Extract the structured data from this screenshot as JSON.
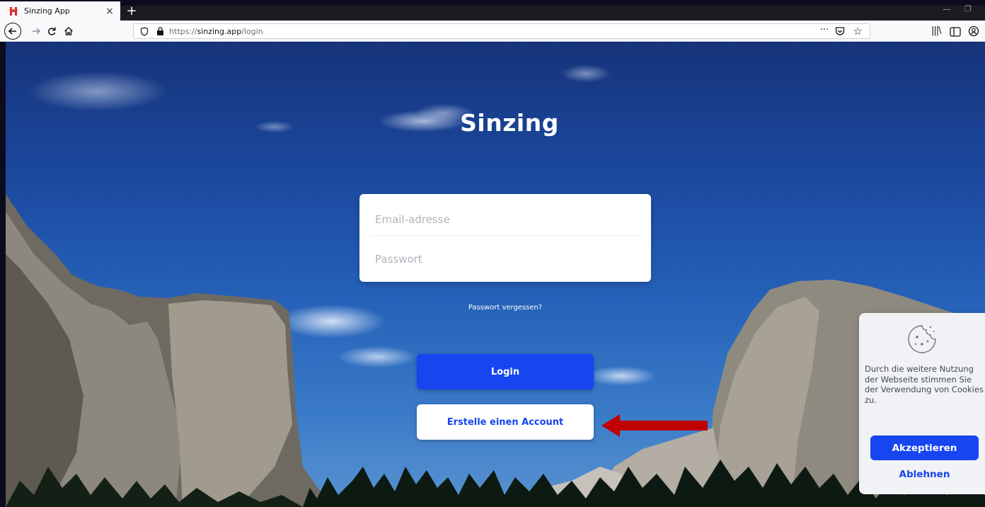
{
  "browser": {
    "tab_title": "Sinzing App",
    "tab_close": "×",
    "new_tab": "+",
    "url_scheme": "https://",
    "url_host": "sinzing.app",
    "url_path": "/login",
    "page_actions": "···",
    "bookmark_star": "☆",
    "library": "|||\\"
  },
  "page": {
    "brand_title": "Sinzing",
    "email_placeholder": "Email-adresse",
    "password_placeholder": "Passwort",
    "forgot_password": "Passwort vergessen?",
    "login_label": "Login",
    "signup_label": "Erstelle einen Account"
  },
  "cookie": {
    "text": "Durch die weitere Nutzung der Webseite stimmen Sie der Verwendung von Cookies zu.",
    "accept_label": "Akzeptieren",
    "decline_label": "Ablehnen"
  },
  "colors": {
    "accent_blue": "#1745f0",
    "annotation_red": "#c00000"
  }
}
